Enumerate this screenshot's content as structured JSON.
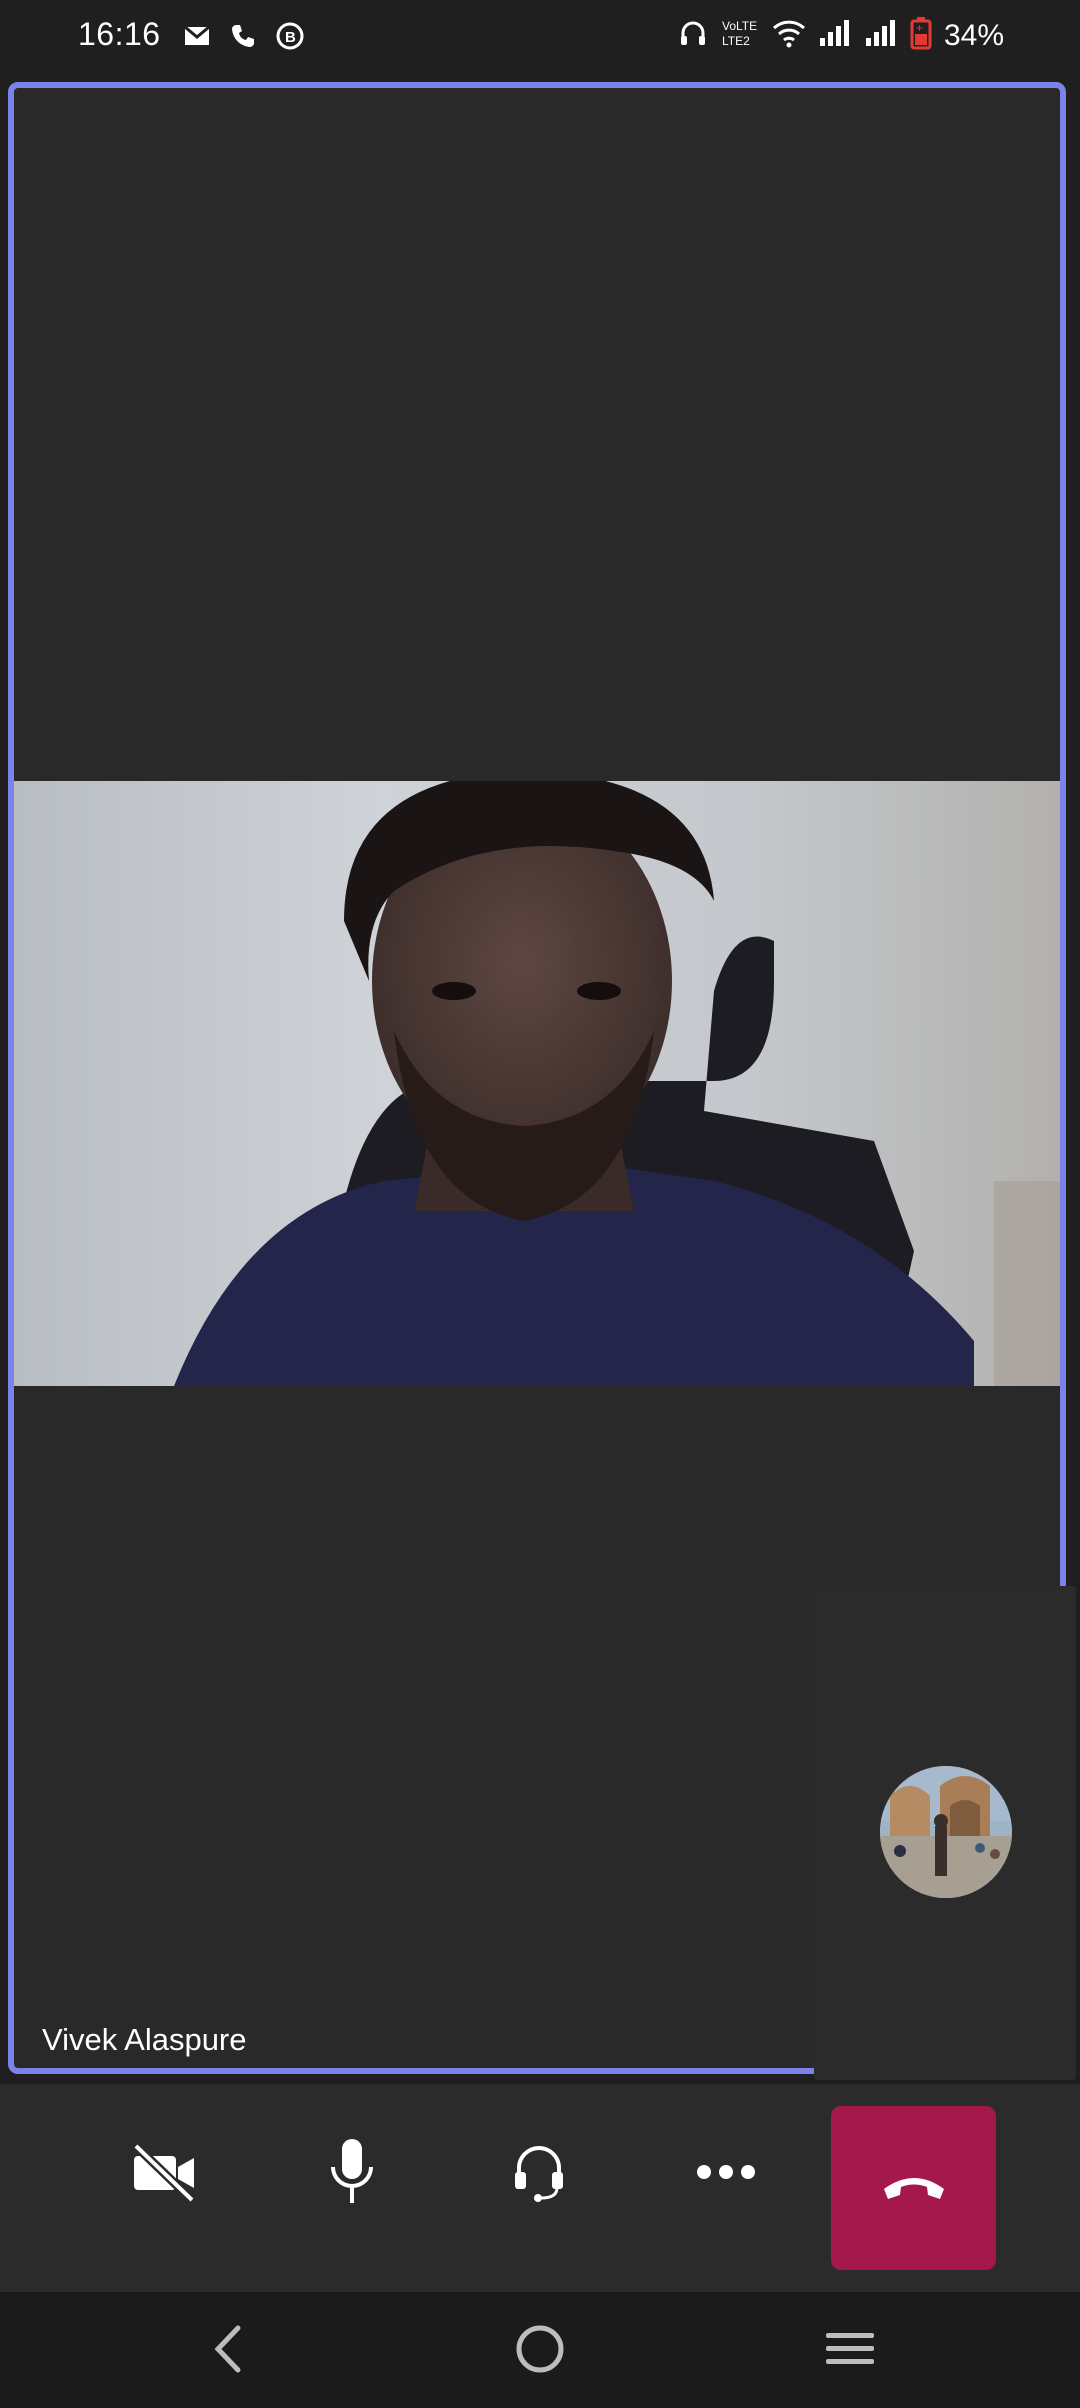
{
  "status_bar": {
    "time": "16:16",
    "left_icons": [
      "gmail-icon",
      "phone-icon",
      "business-chat-icon"
    ],
    "network_label": "VoLTE1 LTE2",
    "battery_text": "34%",
    "battery_color": "#e53935"
  },
  "call": {
    "participant_name": "Vivek Alaspure",
    "active_speaker_color": "#7b83eb"
  },
  "controls": {
    "camera_icon": "camera-off-icon",
    "mic_icon": "microphone-icon",
    "audio_icon": "headset-icon",
    "more_icon": "more-icon",
    "hangup_icon": "hang-up-icon",
    "hangup_color": "#a4184b"
  },
  "nav": {
    "back": "back-icon",
    "home": "home-icon",
    "recents": "recents-icon"
  }
}
